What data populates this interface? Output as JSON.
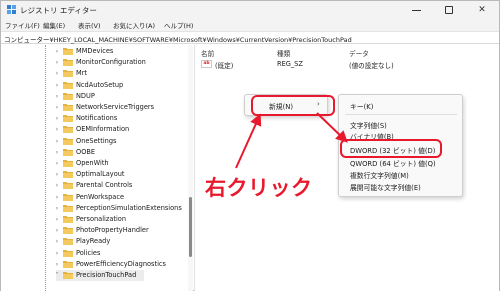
{
  "window": {
    "title": "レジストリ エディター"
  },
  "menubar": [
    "ファイル(F)",
    "編集(E)",
    "表示(V)",
    "お気に入り(A)",
    "ヘルプ(H)"
  ],
  "address": "コンピューター¥HKEY_LOCAL_MACHINE¥SOFTWARE¥Microsoft¥Windows¥CurrentVersion¥PrecisionTouchPad",
  "tree": {
    "items": [
      {
        "label": "MMDevices",
        "expanded": false
      },
      {
        "label": "MonitorConfiguration",
        "expanded": false
      },
      {
        "label": "Mrt",
        "expanded": false
      },
      {
        "label": "NcdAutoSetup",
        "expanded": false
      },
      {
        "label": "NDUP",
        "expanded": false
      },
      {
        "label": "NetworkServiceTriggers",
        "expanded": false
      },
      {
        "label": "Notifications",
        "expanded": false
      },
      {
        "label": "OEMInformation",
        "expanded": false
      },
      {
        "label": "OneSettings",
        "expanded": false
      },
      {
        "label": "OOBE",
        "expanded": false
      },
      {
        "label": "OpenWith",
        "expanded": false
      },
      {
        "label": "OptimalLayout",
        "expanded": false
      },
      {
        "label": "Parental Controls",
        "expanded": false
      },
      {
        "label": "PenWorkspace",
        "expanded": false
      },
      {
        "label": "PerceptionSimulationExtensions",
        "expanded": false
      },
      {
        "label": "Personalization",
        "expanded": false
      },
      {
        "label": "PhotoPropertyHandler",
        "expanded": false
      },
      {
        "label": "PlayReady",
        "expanded": false
      },
      {
        "label": "Policies",
        "expanded": false
      },
      {
        "label": "PowerEfficiencyDiagnostics",
        "expanded": false
      },
      {
        "label": "PrecisionTouchPad",
        "expanded": true,
        "selected": true
      }
    ]
  },
  "values": {
    "headers": {
      "name": "名前",
      "type": "種類",
      "data": "データ"
    },
    "rows": [
      {
        "icon": "ab",
        "name": "(既定)",
        "type": "REG_SZ",
        "data": "(値の設定なし)"
      }
    ]
  },
  "context_menu": {
    "new_label": "新規(N)",
    "submenu": {
      "key": "キー(K)",
      "string": "文字列値(S)",
      "binary": "バイナリ値(B)",
      "dword": "DWORD (32 ビット) 値(D)",
      "qword": "QWORD (64 ビット) 値(Q)",
      "multi_string": "複数行文字列値(M)",
      "expandable_string": "展開可能な文字列値(E)"
    }
  },
  "annotation": {
    "label": "右クリック",
    "color": "#e8192c"
  }
}
